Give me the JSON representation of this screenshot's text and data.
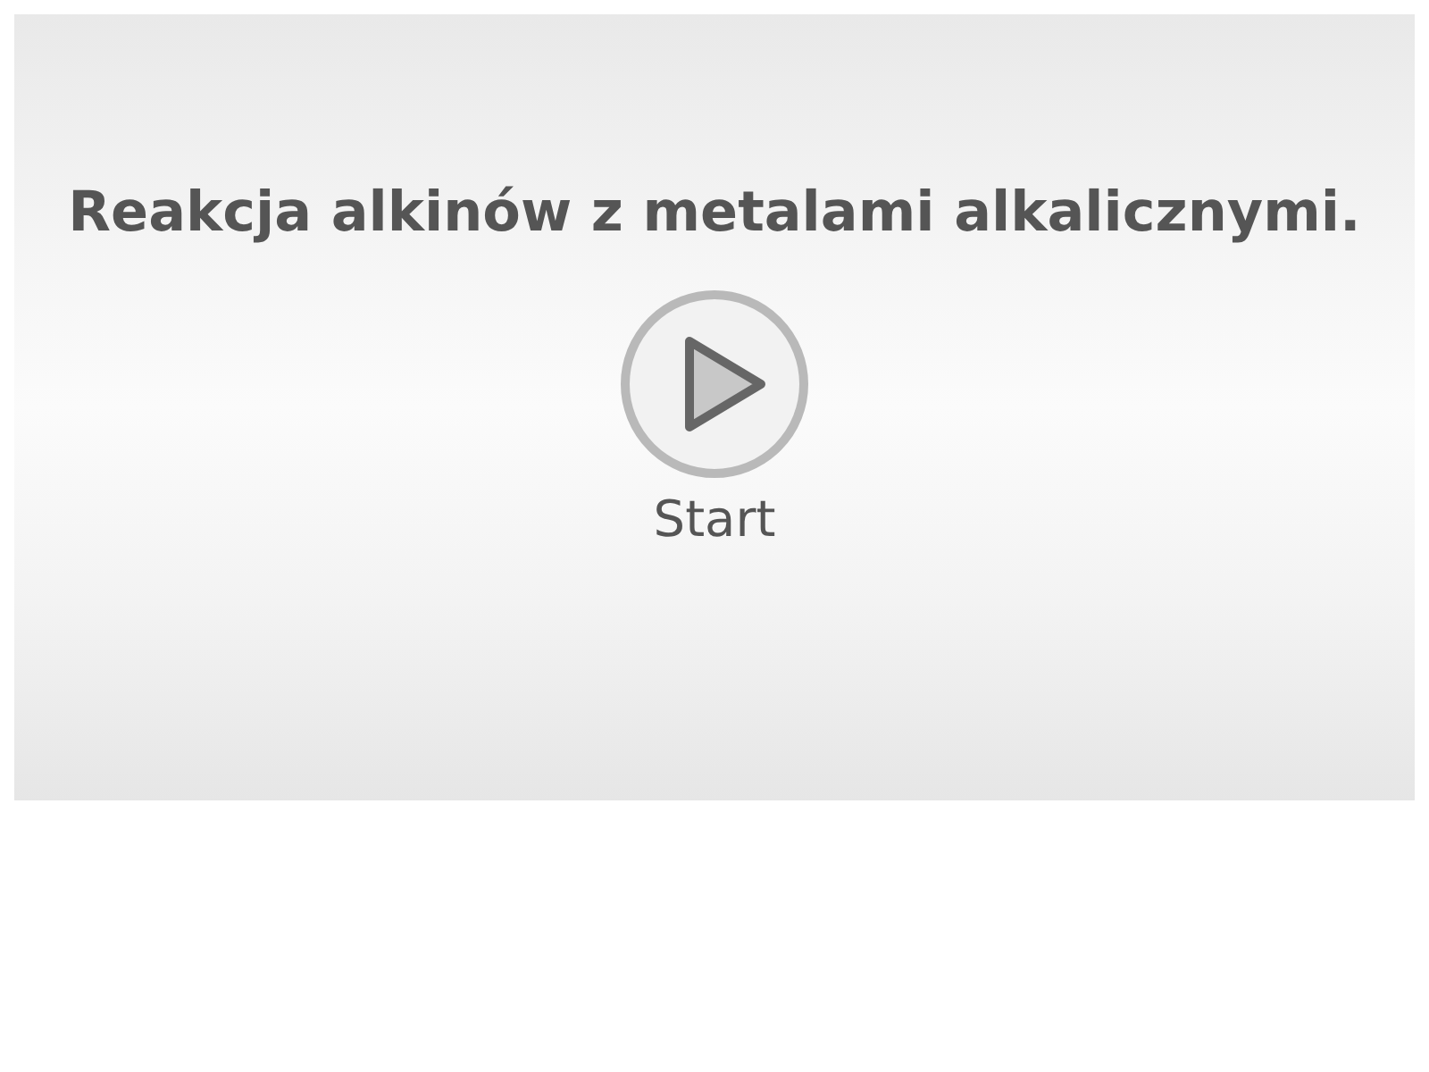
{
  "title": "Reakcja alkinów z metalami alkalicznymi.",
  "start_button": {
    "label": "Start"
  }
}
